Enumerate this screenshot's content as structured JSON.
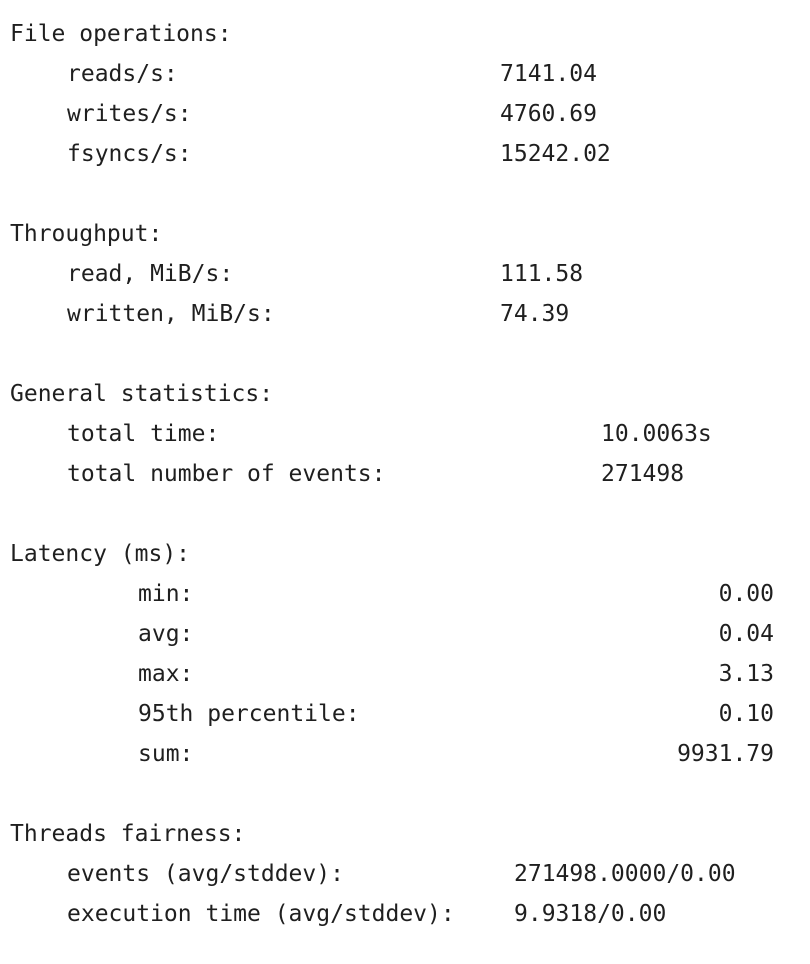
{
  "file_operations": {
    "header": "File operations:",
    "rows": [
      {
        "label": "reads/s:",
        "value": "7141.04"
      },
      {
        "label": "writes/s:",
        "value": "4760.69"
      },
      {
        "label": "fsyncs/s:",
        "value": "15242.02"
      }
    ]
  },
  "throughput": {
    "header": "Throughput:",
    "rows": [
      {
        "label": "read, MiB/s:",
        "value": "111.58"
      },
      {
        "label": "written, MiB/s:",
        "value": "74.39"
      }
    ]
  },
  "general_statistics": {
    "header": "General statistics:",
    "rows": [
      {
        "label": "total time:",
        "value": "10.0063s"
      },
      {
        "label": "total number of events:",
        "value": "271498"
      }
    ]
  },
  "latency": {
    "header": "Latency (ms):",
    "rows": [
      {
        "label": "min:",
        "value": "0.00"
      },
      {
        "label": "avg:",
        "value": "0.04"
      },
      {
        "label": "max:",
        "value": "3.13"
      },
      {
        "label": "95th percentile:",
        "value": "0.10"
      },
      {
        "label": "sum:",
        "value": "9931.79"
      }
    ]
  },
  "threads_fairness": {
    "header": "Threads fairness:",
    "rows": [
      {
        "label": "events (avg/stddev):",
        "value": "271498.0000/0.00"
      },
      {
        "label": "execution time (avg/stddev):",
        "value": "9.9318/0.00"
      }
    ]
  }
}
